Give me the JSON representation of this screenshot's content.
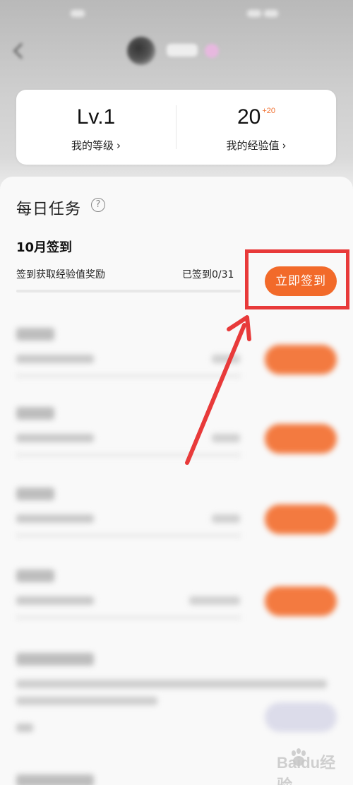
{
  "level_card": {
    "level_value": "Lv.1",
    "level_label": "我的等级",
    "exp_value": "20",
    "exp_bonus": "+20",
    "exp_label": "我的经验值",
    "chevron": "›"
  },
  "daily_tasks": {
    "title": "每日任务",
    "help_icon": "?",
    "signin_task": {
      "title": "10月签到",
      "description": "签到获取经验值奖励",
      "progress_text": "已签到0/31",
      "progress": 0,
      "button_label": "立即签到"
    }
  },
  "colors": {
    "accent": "#f26a2a",
    "highlight": "#e83a3a"
  },
  "watermark": {
    "text": "Baidu经验"
  }
}
